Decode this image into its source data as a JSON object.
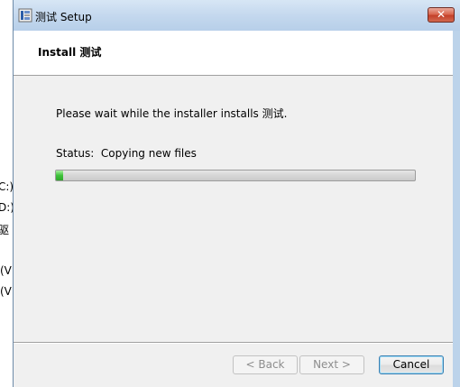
{
  "background_window": {
    "fragments": [
      "C:)",
      "D:)",
      "驱",
      ")",
      " (V",
      " (V"
    ]
  },
  "window": {
    "title": "测试 Setup",
    "close_glyph": "✕"
  },
  "header": {
    "title": "Install 测试"
  },
  "main": {
    "description": "Please wait while the installer installs 测试.",
    "status_label": "Status:",
    "status_value": "Copying new files",
    "progress": 0.02
  },
  "footer": {
    "back_label": "< Back",
    "next_label": "Next >",
    "cancel_label": "Cancel"
  },
  "colors": {
    "progress_fill": "#3ec23a",
    "close_button": "#c4402a",
    "title_bar": "#c4d8ee"
  }
}
